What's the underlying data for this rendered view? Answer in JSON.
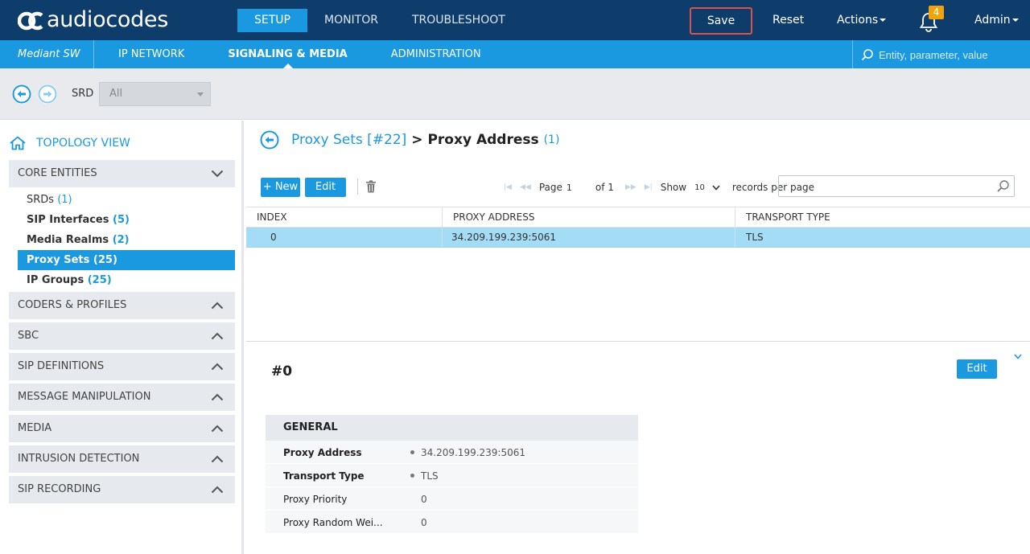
{
  "topbar": {
    "logo_text": "audiocodes",
    "nav": [
      "SETUP",
      "MONITOR",
      "TROUBLESHOOT"
    ],
    "save_label": "Save",
    "reset_label": "Reset",
    "actions_label": "Actions",
    "notifications_count": "4",
    "admin_label": "Admin"
  },
  "subbar": {
    "product": "Mediant SW",
    "nav": [
      "IP NETWORK",
      "SIGNALING & MEDIA",
      "ADMINISTRATION"
    ],
    "active": "SIGNALING & MEDIA",
    "search_placeholder": "Entity, parameter, value"
  },
  "srd": {
    "label": "SRD",
    "value": "All"
  },
  "sidebar": {
    "topology_label": "TOPOLOGY VIEW",
    "core_entities": "CORE ENTITIES",
    "items": [
      {
        "label": "SRDs",
        "count": "(1)"
      },
      {
        "label": "SIP Interfaces",
        "count": "(5)"
      },
      {
        "label": "Media Realms",
        "count": "(2)"
      },
      {
        "label": "Proxy Sets",
        "count": "(25)"
      },
      {
        "label": "IP Groups",
        "count": "(25)"
      }
    ],
    "sections": [
      "CODERS & PROFILES",
      "SBC",
      "SIP DEFINITIONS",
      "MESSAGE MANIPULATION",
      "MEDIA",
      "INTRUSION DETECTION",
      "SIP RECORDING"
    ]
  },
  "main": {
    "breadcrumb_link": "Proxy Sets [#22]",
    "breadcrumb_current": "> Proxy Address",
    "breadcrumb_count": "(1)",
    "new_label": "+ New",
    "edit_label": "Edit",
    "pager": {
      "page_label": "Page",
      "page_value": "1",
      "of_label": "of 1",
      "show_label": "Show",
      "show_value": "10",
      "records_label": "records per page"
    },
    "columns": [
      "INDEX",
      "PROXY ADDRESS",
      "TRANSPORT TYPE"
    ],
    "rows": [
      {
        "index": "0",
        "proxy_address": "34.209.199.239:5061",
        "transport_type": "TLS"
      }
    ],
    "record_title": "#0",
    "record_edit_label": "Edit",
    "details": {
      "header": "GENERAL",
      "fields": [
        {
          "key": "Proxy Address",
          "value": "34.209.199.239:5061"
        },
        {
          "key": "Transport Type",
          "value": "TLS"
        },
        {
          "key": "Proxy Priority",
          "value": "0"
        },
        {
          "key": "Proxy Random Wei...",
          "value": "0"
        }
      ]
    }
  },
  "colors": {
    "navy": "#0f3d6b",
    "accent": "#1a99e0",
    "save_outline": "#d9534f",
    "badge": "#f0a30a",
    "selected_row": "#a5dcf5"
  }
}
